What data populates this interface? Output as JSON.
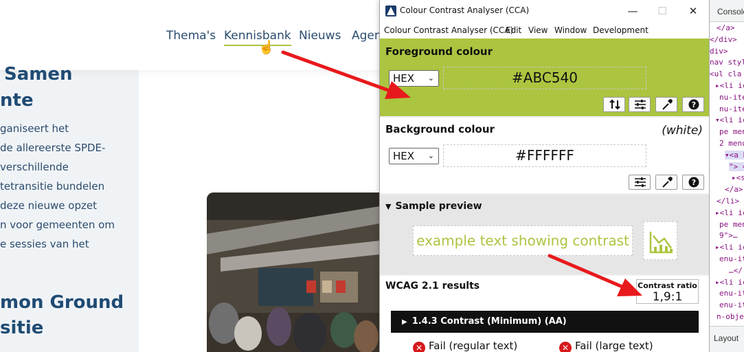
{
  "website": {
    "nav": [
      "Thema's",
      "Kennisbank",
      "Nieuws",
      "Agen"
    ],
    "heading1": [
      "Samen",
      "nte"
    ],
    "body_lines": [
      "ganiseert het",
      "de allereerste SPDE-",
      "verschillende",
      "tetransitie bundelen",
      "deze nieuwe opzet",
      "n voor gemeenten om",
      "e sessies van het"
    ],
    "heading2": [
      "mon Ground",
      "sitie"
    ]
  },
  "cca": {
    "title": "Colour Contrast Analyser (CCA)",
    "menu": [
      "Colour Contrast Analyser (CCA)",
      "Edit",
      "View",
      "Window",
      "Development"
    ],
    "foreground": {
      "title": "Foreground colour",
      "format": "HEX",
      "value": "#ABC540",
      "color": "#abc540"
    },
    "background": {
      "title": "Background colour",
      "name": "(white)",
      "format": "HEX",
      "value": "#FFFFFF",
      "color": "#ffffff"
    },
    "preview": {
      "title": "Sample preview",
      "sample_text": "example text showing contrast"
    },
    "wcag": {
      "title": "WCAG 2.1 results",
      "ratio_label": "Contrast ratio",
      "ratio_value": "1,9:1",
      "criterion": "1.4.3 Contrast (Minimum) (AA)",
      "regular": "Fail (regular text)",
      "large": "Fail (large text)"
    }
  },
  "devtools": {
    "tab": "Console",
    "lines": [
      "</a>",
      "</div>",
      "div>",
      "nav styl",
      "<ul cla",
      "▸<li ic",
      "nu-ite",
      "nu-ite",
      "▾<li ic",
      "pe men",
      "2 menu",
      "▾<a h",
      "\"> =",
      "▸<s",
      "</a>",
      "</li>",
      "▸<li ic",
      "pe men",
      "9\">…",
      "▸<li ic",
      "enu-it",
      "…</",
      "▸<li ic",
      "enu-it",
      "enu-it",
      "n-object-"
    ],
    "bottom_tab": "Layout"
  },
  "colors": {
    "accent": "#abc540",
    "arrow": "#e8191c",
    "navy": "#1f4b73"
  }
}
